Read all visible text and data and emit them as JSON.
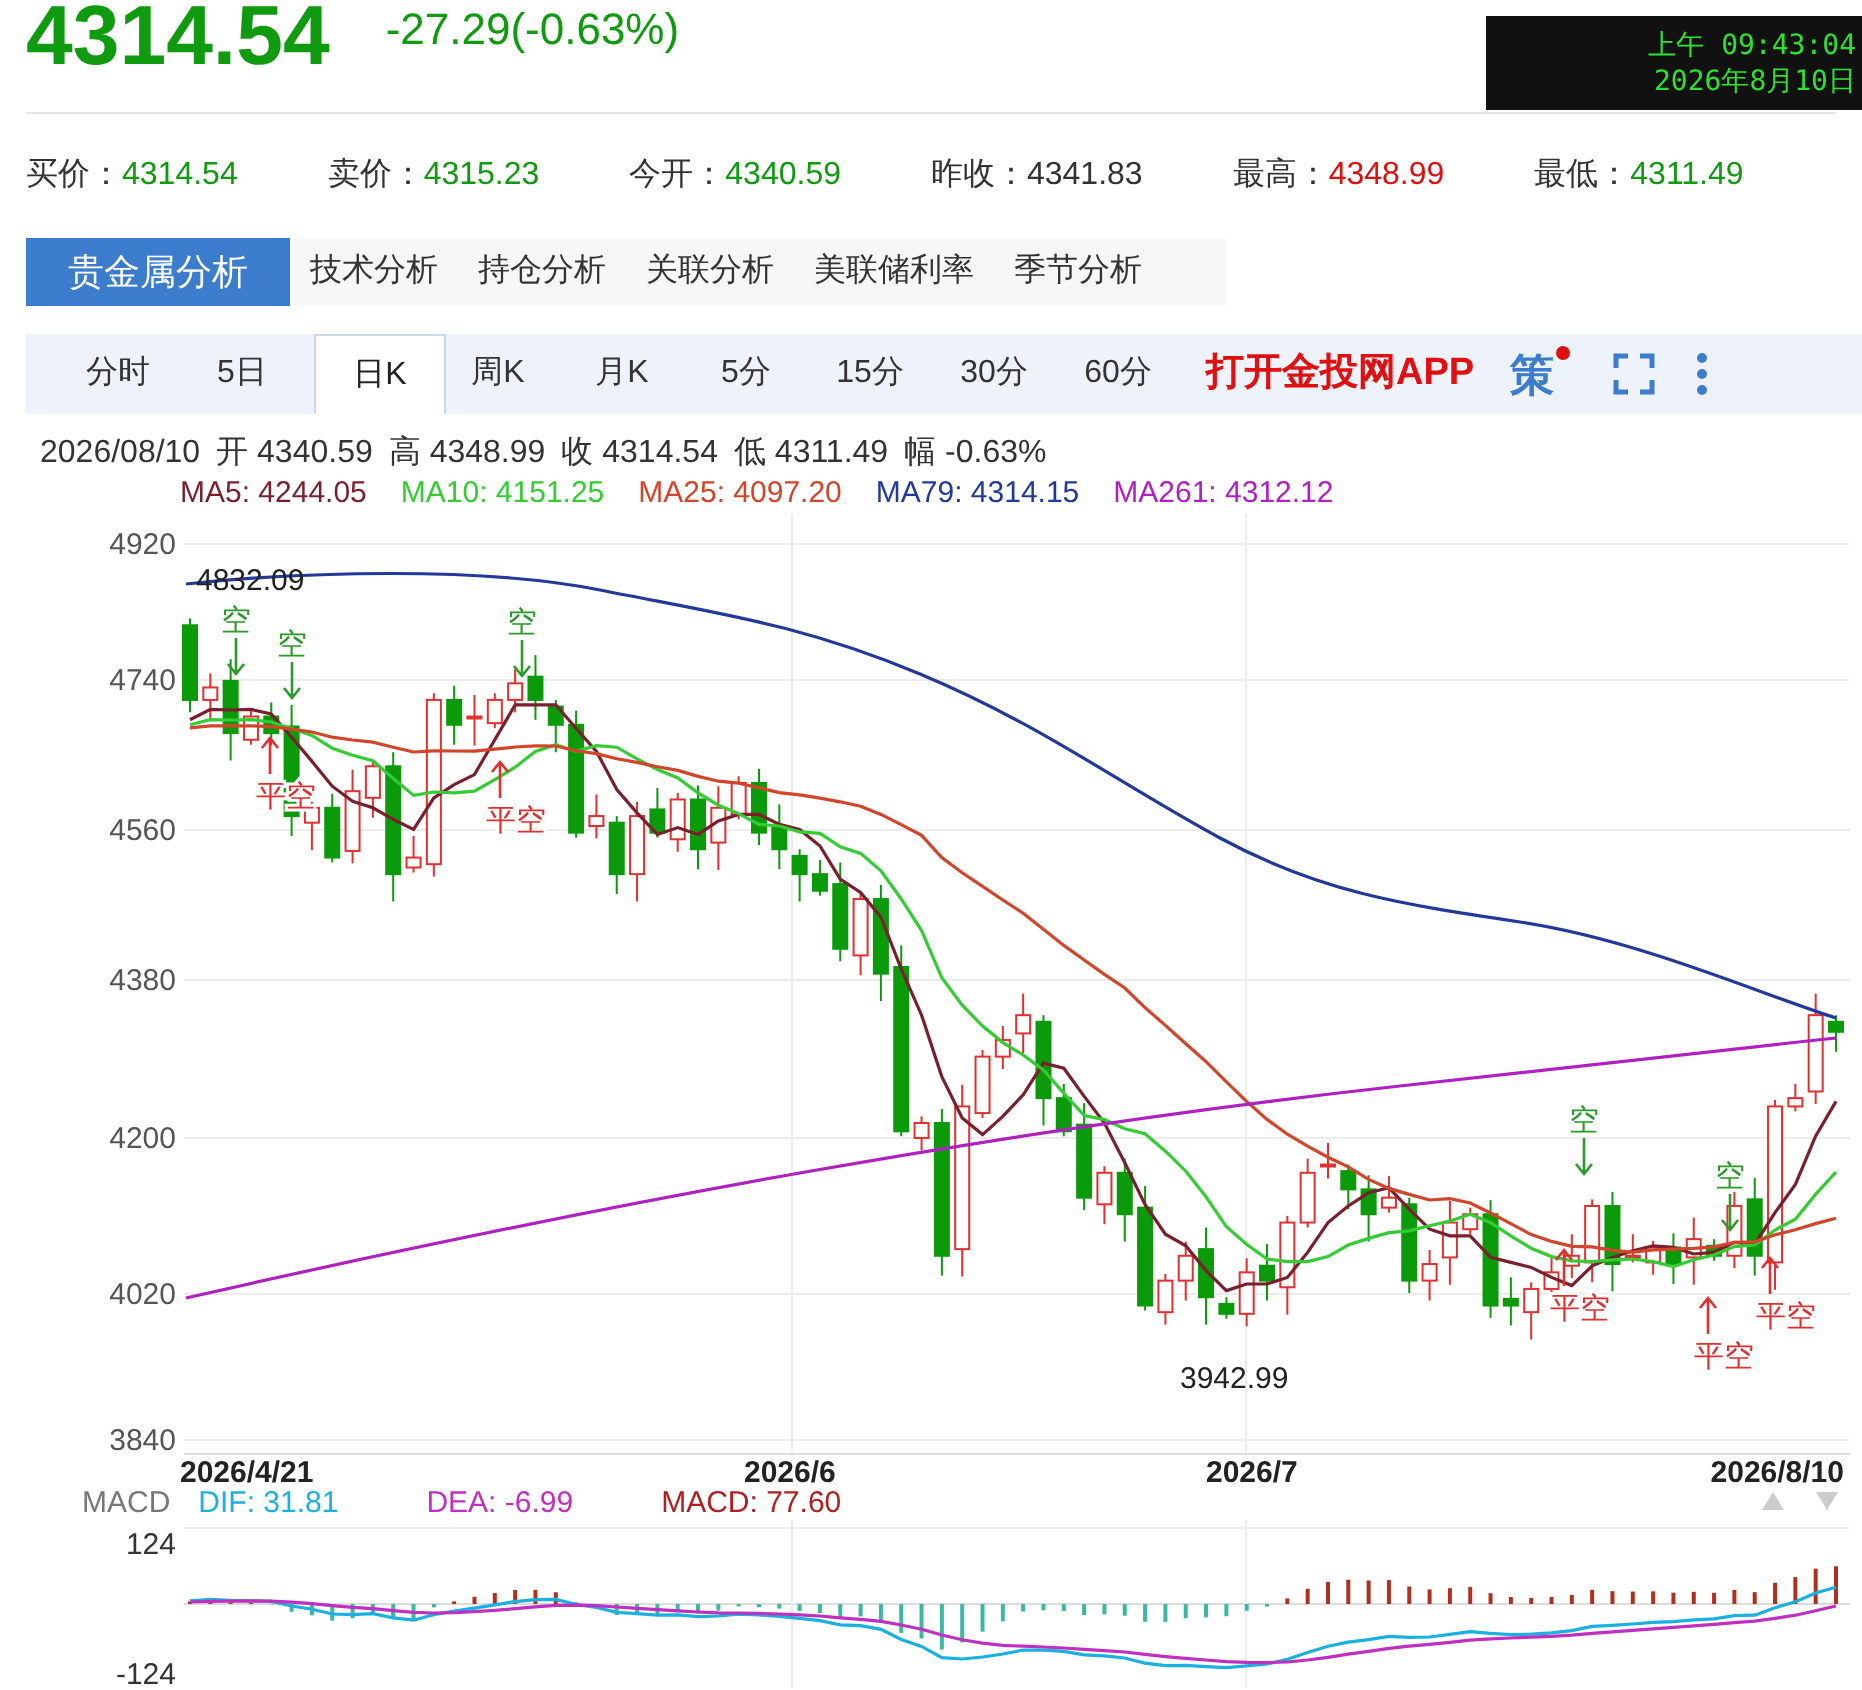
{
  "quote": {
    "price": "4314.54",
    "change": "-27.29(-0.63%)",
    "clock": {
      "time": "上午 09:43:04",
      "date": "2026年8月10日"
    }
  },
  "stats": [
    {
      "label": "买价：",
      "value": "4314.54",
      "color": "#109a10"
    },
    {
      "label": "卖价：",
      "value": "4315.23",
      "color": "#109a10"
    },
    {
      "label": "今开：",
      "value": "4340.59",
      "color": "#109a10"
    },
    {
      "label": "昨收：",
      "value": "4341.83",
      "color": "#333333"
    },
    {
      "label": "最高：",
      "value": "4348.99",
      "color": "#e01010"
    },
    {
      "label": "最低：",
      "value": "4311.49",
      "color": "#109a10"
    }
  ],
  "analysis_tabs": [
    {
      "label": "贵金属分析",
      "selected": true
    },
    {
      "label": "技术分析",
      "selected": false
    },
    {
      "label": "持仓分析",
      "selected": false
    },
    {
      "label": "关联分析",
      "selected": false
    },
    {
      "label": "美联储利率",
      "selected": false
    },
    {
      "label": "季节分析",
      "selected": false
    }
  ],
  "period_tabs": [
    {
      "label": "分时",
      "selected": false
    },
    {
      "label": "5日",
      "selected": false
    },
    {
      "label": "日K",
      "selected": true
    },
    {
      "label": "周K",
      "selected": false
    },
    {
      "label": "月K",
      "selected": false
    },
    {
      "label": "5分",
      "selected": false
    },
    {
      "label": "15分",
      "selected": false
    },
    {
      "label": "30分",
      "selected": false
    },
    {
      "label": "60分",
      "selected": false
    }
  ],
  "app_link": "打开金投网APP",
  "strategy_button": {
    "label": "策",
    "badge": true
  },
  "info_line": {
    "date": "2026/08/10",
    "items": [
      {
        "label": "开",
        "value": "4340.59"
      },
      {
        "label": "高",
        "value": "4348.99"
      },
      {
        "label": "收",
        "value": "4314.54"
      },
      {
        "label": "低",
        "value": "4311.49"
      },
      {
        "label": "幅",
        "value": "-0.63%"
      }
    ]
  },
  "moving_averages": [
    {
      "label": "MA5: 4244.05",
      "color": "#7a1f2e"
    },
    {
      "label": "MA10: 4151.25",
      "color": "#33cc33"
    },
    {
      "label": "MA25: 4097.20",
      "color": "#d2452a"
    },
    {
      "label": "MA79: 4314.15",
      "color": "#22389a"
    },
    {
      "label": "MA261: 4312.12",
      "color": "#b020c0"
    }
  ],
  "chart": {
    "yticks": [
      "4920",
      "4740",
      "4560",
      "4380",
      "4200",
      "4020",
      "3840"
    ],
    "xticks": [
      "2026/4/21",
      "2026/6",
      "2026/7",
      "2026/8/10"
    ],
    "high_label": "4832.09",
    "low_label": "3942.99",
    "signals": [
      {
        "kind": "short",
        "text": "空"
      },
      {
        "kind": "short",
        "text": "空"
      },
      {
        "kind": "short",
        "text": "空"
      },
      {
        "kind": "short",
        "text": "空"
      },
      {
        "kind": "short",
        "text": "空"
      },
      {
        "kind": "cover",
        "text": "平空"
      },
      {
        "kind": "cover",
        "text": "平空"
      },
      {
        "kind": "cover",
        "text": "平空"
      },
      {
        "kind": "cover",
        "text": "平空"
      },
      {
        "kind": "cover",
        "text": "平空"
      }
    ]
  },
  "macd": {
    "title": "MACD",
    "legend": [
      {
        "label": "DIF: 31.81",
        "color": "#1ab0e0"
      },
      {
        "label": "DEA: -6.99",
        "color": "#c030c0"
      },
      {
        "label": "MACD: 77.60",
        "color": "#b02020"
      }
    ],
    "yticks": [
      "124",
      "-124"
    ]
  }
}
